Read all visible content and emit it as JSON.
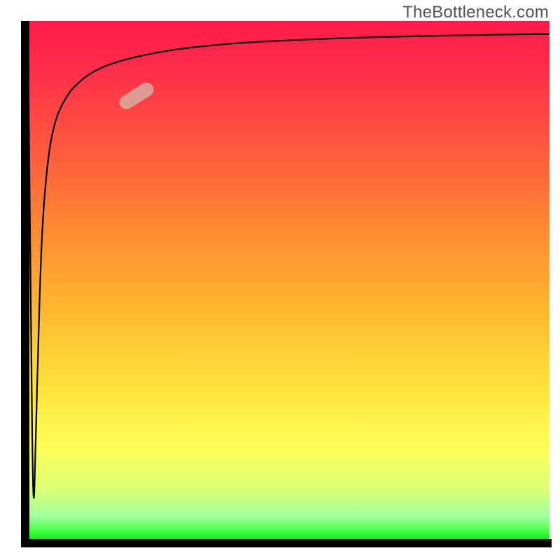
{
  "watermark": "TheBottleneck.com",
  "chart_data": {
    "type": "line",
    "title": "",
    "xlabel": "",
    "ylabel": "",
    "xlim": [
      0,
      100
    ],
    "ylim": [
      0,
      100
    ],
    "grid": false,
    "series": [
      {
        "name": "curve",
        "x": [
          0,
          0.5,
          1,
          1.5,
          2,
          2.5,
          3,
          4,
          5,
          6,
          8,
          10,
          12,
          15,
          20,
          25,
          30,
          40,
          50,
          60,
          70,
          80,
          90,
          100
        ],
        "y": [
          97,
          50,
          2,
          20,
          40,
          55,
          65,
          75,
          80,
          83,
          86.5,
          88.5,
          90,
          91.5,
          93,
          94,
          94.8,
          95.8,
          96.3,
          96.7,
          97,
          97.2,
          97.4,
          97.5
        ]
      }
    ],
    "marker": {
      "x_norm": 0.208,
      "y_norm": 0.857,
      "rotation_deg": -32
    },
    "gradient": {
      "stops": [
        {
          "pos": 0.0,
          "color": "#ff1a4a"
        },
        {
          "pos": 0.1,
          "color": "#ff2f4a"
        },
        {
          "pos": 0.25,
          "color": "#ff5a3d"
        },
        {
          "pos": 0.4,
          "color": "#ff8a32"
        },
        {
          "pos": 0.55,
          "color": "#ffb72f"
        },
        {
          "pos": 0.7,
          "color": "#ffe23a"
        },
        {
          "pos": 0.82,
          "color": "#feff58"
        },
        {
          "pos": 0.9,
          "color": "#d8ff78"
        },
        {
          "pos": 0.95,
          "color": "#a0ffa0"
        },
        {
          "pos": 0.98,
          "color": "#3fff3f"
        },
        {
          "pos": 1.0,
          "color": "#00e000"
        }
      ]
    }
  }
}
